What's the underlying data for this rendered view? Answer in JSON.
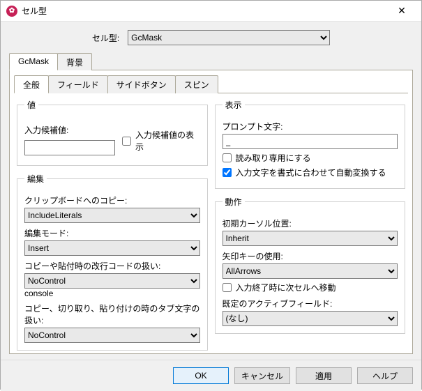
{
  "window": {
    "title": "セル型"
  },
  "celltype": {
    "label": "セル型:",
    "value": "GcMask"
  },
  "outerTabs": [
    "GcMask",
    "背景"
  ],
  "innerTabs": [
    "全般",
    "フィールド",
    "サイドボタン",
    "スピン"
  ],
  "value_group": {
    "legend": "値",
    "input_label": "入力候補値:",
    "input_value": "",
    "show_candidates_label": "入力候補値の表示"
  },
  "edit_group": {
    "legend": "編集",
    "clipboard_label": "クリップボードへのコピー:",
    "clipboard_value": "IncludeLiterals",
    "edit_mode_label": "編集モード:",
    "edit_mode_value": "Insert",
    "paste_newline_label": "コピーや貼付時の改行コードの扱い:",
    "paste_newline_value": "NoControl",
    "tab_label": "コピー、切り取り、貼り付けの時のタブ文字の扱い:",
    "tab_value": "NoControl"
  },
  "display_group": {
    "legend": "表示",
    "prompt_label": "プロンプト文字:",
    "prompt_value": "_",
    "readonly_label": "読み取り専用にする",
    "autoconvert_label": "入力文字を書式に合わせて自動変換する",
    "autoconvert_checked": true
  },
  "behavior_group": {
    "legend": "動作",
    "caret_label": "初期カーソル位置:",
    "caret_value": "Inherit",
    "arrow_label": "矢印キーの使用:",
    "arrow_value": "AllArrows",
    "exit_label": "入力終了時に次セルへ移動",
    "active_field_label": "既定のアクティブフィールド:",
    "active_field_value": "(なし)"
  },
  "buttons": {
    "ok": "OK",
    "cancel": "キャンセル",
    "apply": "適用",
    "help": "ヘルプ"
  }
}
